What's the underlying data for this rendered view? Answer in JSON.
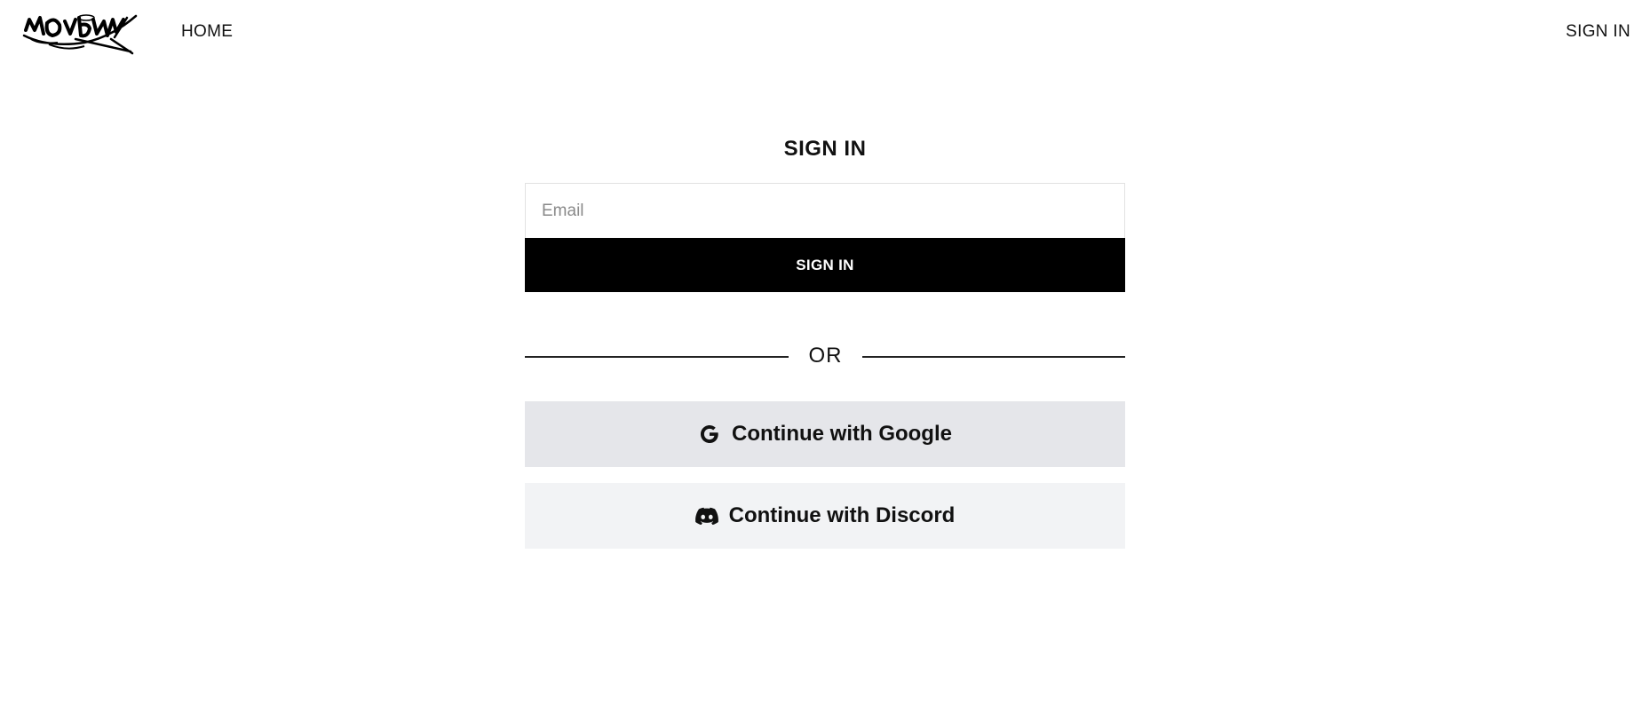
{
  "header": {
    "logo_alt": "MOMBY",
    "nav_home": "HOME",
    "nav_signin": "SIGN IN"
  },
  "signin": {
    "title": "SIGN IN",
    "email_placeholder": "Email",
    "email_value": "",
    "submit_label": "SIGN IN"
  },
  "divider": {
    "text": "OR"
  },
  "oauth": {
    "google_label": "Continue with Google",
    "google_icon": "google-icon",
    "discord_label": "Continue with Discord",
    "discord_icon": "discord-icon"
  },
  "colors": {
    "primary_button": "#000000",
    "google_button_bg": "#e5e6ea",
    "discord_button_bg": "#f2f3f5"
  }
}
